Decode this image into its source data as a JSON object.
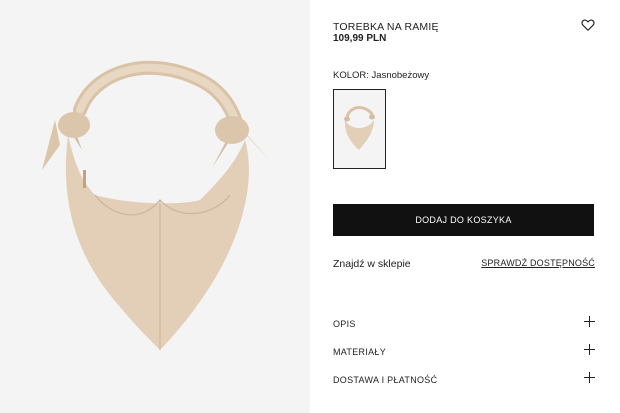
{
  "product": {
    "title": "TOREBKA NA RAMIĘ",
    "price": "109,99 PLN",
    "color_label": "KOLOR:",
    "color_value": "Jasnobeżowy",
    "bag_color": "#e3cfb7",
    "bag_shadow": "#cbb49a"
  },
  "icons": {
    "favorite": "heart-outline-icon",
    "expand": "plus-icon"
  },
  "actions": {
    "add_to_cart": "DODAJ DO KOSZYKA",
    "find_in_store": "Znajdź w sklepie",
    "check_availability": "SPRAWDŹ DOSTĘPNOŚĆ"
  },
  "accordion": [
    {
      "label": "OPIS"
    },
    {
      "label": "MATERIAŁY"
    },
    {
      "label": "DOSTAWA I PŁATNOŚĆ"
    }
  ]
}
